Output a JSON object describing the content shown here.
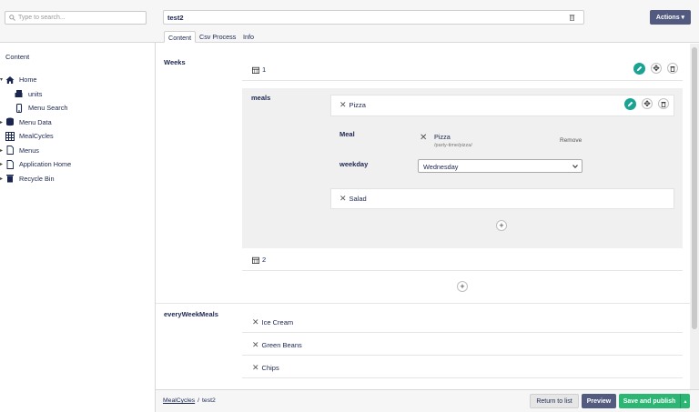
{
  "search": {
    "placeholder": "Type to search..."
  },
  "sidebar": {
    "title": "Content",
    "items": [
      {
        "label": "Home",
        "icon": "home-icon"
      },
      {
        "label": "units",
        "icon": "units-icon"
      },
      {
        "label": "Menu Search",
        "icon": "mobile-icon"
      },
      {
        "label": "Menu Data",
        "icon": "database-icon"
      },
      {
        "label": "MealCycles",
        "icon": "grid-icon"
      },
      {
        "label": "Menus",
        "icon": "document-icon"
      },
      {
        "label": "Application Home",
        "icon": "document-icon"
      },
      {
        "label": "Recycle Bin",
        "icon": "trash-icon"
      }
    ]
  },
  "header": {
    "name": "test2",
    "actions_label": "Actions ▾",
    "tabs": [
      "Content",
      "Csv Process",
      "Info"
    ]
  },
  "content": {
    "weeks_label": "Weeks",
    "week1": "1",
    "week2": "2",
    "meals_label": "meals",
    "meal1": "Pizza",
    "meal_label": "Meal",
    "meal_name": "Pizza",
    "meal_path": "/party-time/pizza/",
    "remove_label": "Remove",
    "weekday_label": "weekday",
    "weekday_value": "Wednesday",
    "meal2": "Salad",
    "every_week_label": "everyWeekMeals",
    "every_week_items": [
      "Ice Cream",
      "Green Beans",
      "Chips"
    ]
  },
  "footer": {
    "breadcrumb_link": "MealCycles",
    "breadcrumb_sep": "/",
    "breadcrumb_current": "test2",
    "return_label": "Return to list",
    "preview_label": "Preview",
    "save_label": "Save and publish",
    "save_caret": "▴"
  },
  "colors": {
    "accent": "#1aa393",
    "save": "#2bb673",
    "preview": "#525a7f",
    "actions": "#525a7f"
  }
}
